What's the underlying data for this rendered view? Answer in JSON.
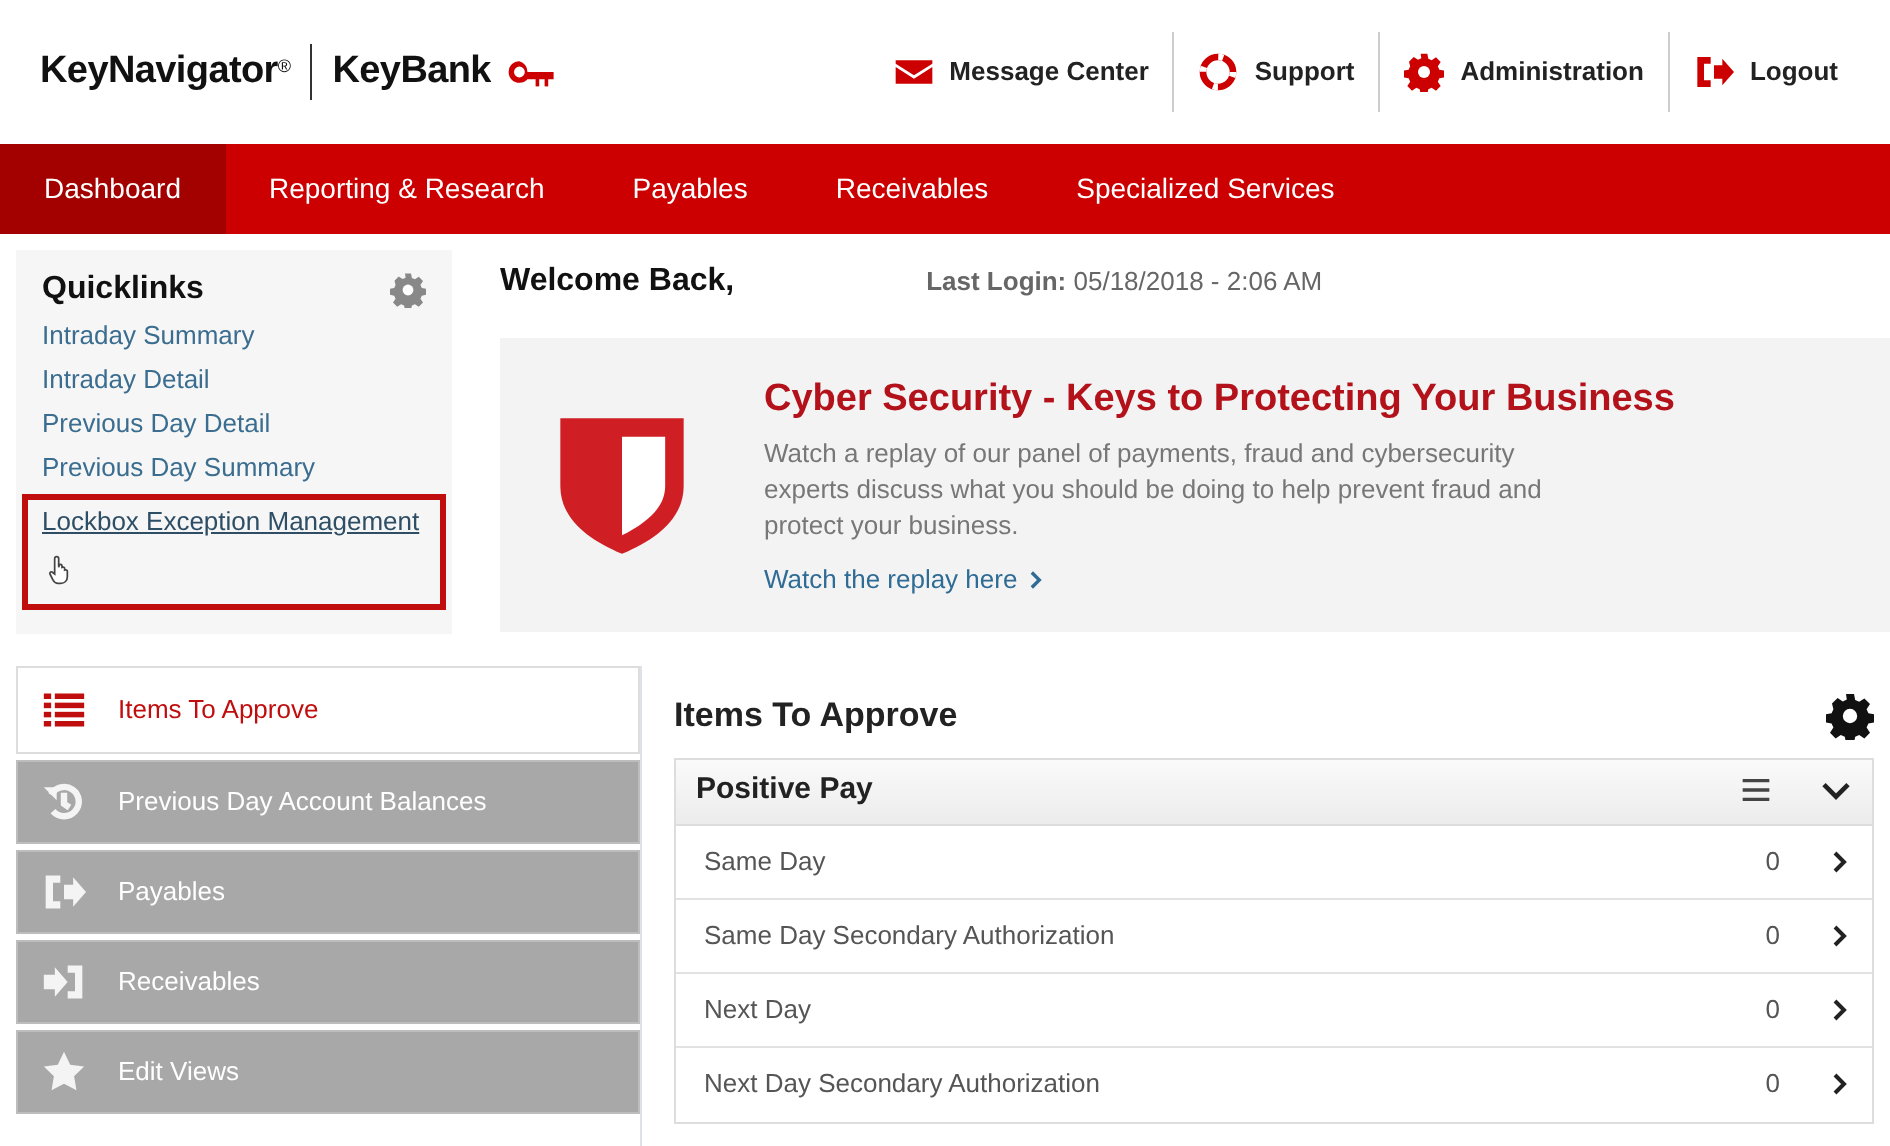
{
  "header": {
    "product": "KeyNavigator",
    "product_mark": "®",
    "bank": "KeyBank",
    "links": [
      "Message Center",
      "Support",
      "Administration",
      "Logout"
    ]
  },
  "nav": [
    {
      "label": "Dashboard",
      "selected": true
    },
    {
      "label": "Reporting & Research",
      "selected": false
    },
    {
      "label": "Payables",
      "selected": false
    },
    {
      "label": "Receivables",
      "selected": false
    },
    {
      "label": "Specialized Services",
      "selected": false
    }
  ],
  "quicklinks": {
    "title": "Quicklinks",
    "items": [
      {
        "label": "Intraday Summary",
        "highlighted": false
      },
      {
        "label": "Intraday Detail",
        "highlighted": false
      },
      {
        "label": "Previous Day Detail",
        "highlighted": false
      },
      {
        "label": "Previous Day Summary",
        "highlighted": false
      },
      {
        "label": "Lockbox Exception Management",
        "highlighted": true
      }
    ]
  },
  "welcome": "Welcome Back,",
  "last_login_label": "Last Login:",
  "last_login": "05/18/2018 - 2:06 AM",
  "banner": {
    "title": "Cyber Security - Keys to Protecting Your Business",
    "text": "Watch a replay of our panel of payments, fraud and cybersecurity experts discuss what you should be doing to help prevent fraud and protect your business.",
    "link": "Watch the replay here"
  },
  "side_tabs": [
    {
      "label": "Items To Approve",
      "selected": true
    },
    {
      "label": "Previous Day Account Balances",
      "selected": false
    },
    {
      "label": "Payables",
      "selected": false
    },
    {
      "label": "Receivables",
      "selected": false
    },
    {
      "label": "Edit Views",
      "selected": false
    }
  ],
  "panel": {
    "title": "Items To Approve",
    "section": "Positive Pay",
    "rows": [
      {
        "label": "Same Day",
        "count": "0"
      },
      {
        "label": "Same Day Secondary Authorization",
        "count": "0"
      },
      {
        "label": "Next Day",
        "count": "0"
      },
      {
        "label": "Next Day Secondary Authorization",
        "count": "0"
      }
    ]
  }
}
